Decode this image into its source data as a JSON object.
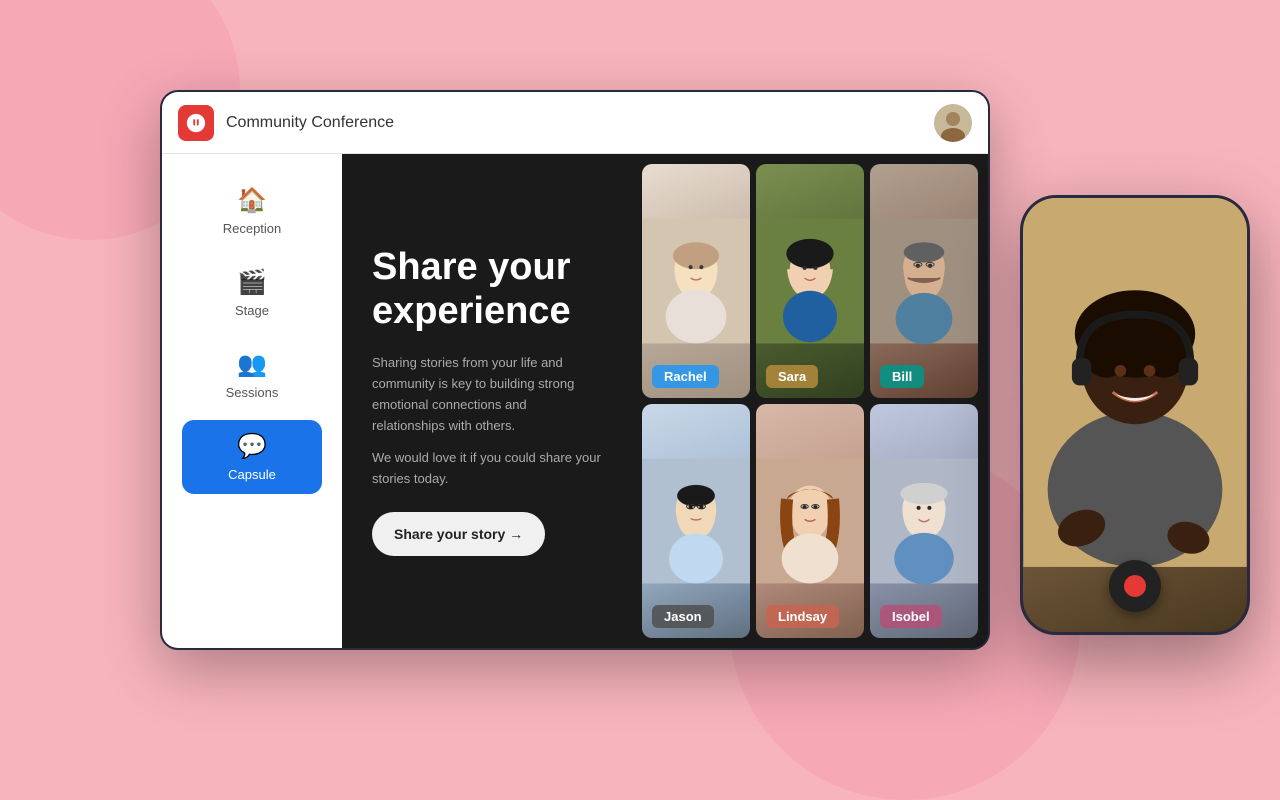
{
  "app": {
    "title": "Community Conference",
    "logo_label": "Logo"
  },
  "sidebar": {
    "items": [
      {
        "id": "reception",
        "label": "Reception",
        "icon": "🏠",
        "active": false
      },
      {
        "id": "stage",
        "label": "Stage",
        "icon": "🎬",
        "active": false
      },
      {
        "id": "sessions",
        "label": "Sessions",
        "icon": "👥",
        "active": false
      },
      {
        "id": "capsule",
        "label": "Capsule",
        "icon": "💬",
        "active": true
      }
    ]
  },
  "main": {
    "heading": "Share your experience",
    "description1": "Sharing stories from your life and community is key to building strong emotional connections and relationships with others.",
    "description2": "We would love it if you could share your stories today.",
    "cta_button": "Share your story →"
  },
  "video_grid": {
    "participants": [
      {
        "id": "rachel",
        "name": "Rachel",
        "badge_color": "badge-blue",
        "row": 0,
        "col": 0
      },
      {
        "id": "sara",
        "name": "Sara",
        "badge_color": "badge-gold",
        "row": 0,
        "col": 1
      },
      {
        "id": "bill",
        "name": "Bill",
        "badge_color": "badge-teal",
        "row": 0,
        "col": 2
      },
      {
        "id": "jason",
        "name": "Jason",
        "badge_color": "badge-gray",
        "row": 1,
        "col": 0
      },
      {
        "id": "lindsay",
        "name": "Lindsay",
        "badge_color": "badge-peach",
        "row": 1,
        "col": 1
      },
      {
        "id": "isobel",
        "name": "Isobel",
        "badge_color": "badge-pink",
        "row": 1,
        "col": 2
      }
    ]
  },
  "phone": {
    "record_button_label": "Stop recording"
  }
}
